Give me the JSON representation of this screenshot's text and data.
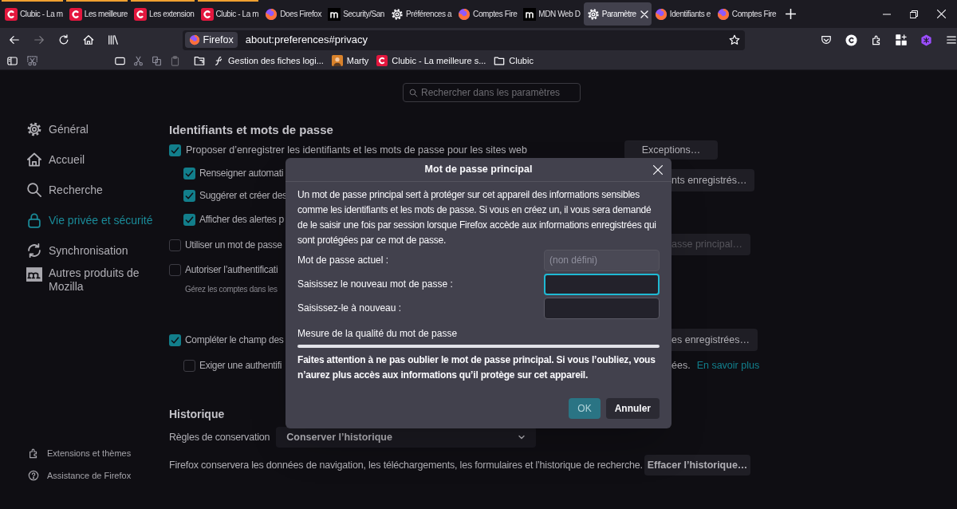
{
  "tabs": [
    {
      "title": "Clubic - La m",
      "kind": "clubic",
      "selected": false,
      "color": "#f0a030"
    },
    {
      "title": "Les meilleure",
      "kind": "clubic",
      "selected": false,
      "color": "#f0a030"
    },
    {
      "title": "Les extension",
      "kind": "clubic",
      "selected": false,
      "color": "#f0a030"
    },
    {
      "title": "Clubic - La m",
      "kind": "clubic",
      "selected": false,
      "color": "#f0a030"
    },
    {
      "title": "Does Firefox",
      "kind": "firefox",
      "selected": false
    },
    {
      "title": "Security/San",
      "kind": "mdn",
      "selected": false
    },
    {
      "title": "Préférences a",
      "kind": "gear",
      "selected": false
    },
    {
      "title": "Comptes Fire",
      "kind": "firefox",
      "selected": false
    },
    {
      "title": "MDN Web D",
      "kind": "mdn",
      "selected": false
    },
    {
      "title": "Paramètre",
      "kind": "gear",
      "selected": true
    },
    {
      "title": "Identifiants e",
      "kind": "firefox",
      "selected": false
    },
    {
      "title": "Comptes Fire",
      "kind": "firefox",
      "selected": false
    }
  ],
  "navbar": {
    "identity": "Firefox",
    "url": "about:preferences#privacy"
  },
  "bookmarks": [
    {
      "label": "Gestion des fiches logi...",
      "kind": "script"
    },
    {
      "label": "Marty",
      "kind": "avatar"
    },
    {
      "label": "Clubic - La meilleure s...",
      "kind": "clubic"
    },
    {
      "label": "Clubic",
      "kind": "folder"
    }
  ],
  "search": {
    "placeholder": "Rechercher dans les paramètres"
  },
  "sidebar": {
    "items": [
      {
        "label": "Général",
        "kind": "general",
        "selected": false
      },
      {
        "label": "Accueil",
        "kind": "home",
        "selected": false
      },
      {
        "label": "Recherche",
        "kind": "search",
        "selected": false
      },
      {
        "label": "Vie privée et sécurité",
        "kind": "privacy",
        "selected": true
      },
      {
        "label": "Synchronisation",
        "kind": "sync",
        "selected": false
      },
      {
        "label": "Autres produits de Mozilla",
        "kind": "mozilla",
        "selected": false
      }
    ],
    "footer": [
      {
        "label": "Extensions et thèmes",
        "kind": "extensions"
      },
      {
        "label": "Assistance de Firefox",
        "kind": "help"
      }
    ]
  },
  "passwords": {
    "heading": "Identifiants et mots de passe",
    "offer": {
      "label": "Proposer d’enregistrer les identifiants et les mots de passe pour les sites web",
      "checked": true,
      "button": "Exceptions…"
    },
    "rows": [
      {
        "label": "Renseigner automati",
        "checked": true,
        "children": []
      },
      {
        "label": "Suggérer et créer des",
        "checked": true
      },
      {
        "label": "Afficher des alertes p",
        "checked": true
      },
      {
        "label": "Utiliser un mot de passe",
        "checked": false
      },
      {
        "label": "Autoriser l’authentificati",
        "checked": false,
        "description": "Gérez les comptes dans les"
      },
      {
        "label": "Compléter le champ des",
        "checked": true
      },
      {
        "label": "Exiger une authentifi",
        "checked": false
      }
    ],
    "right_buttons": [
      {
        "label": "nts enregistrés…",
        "disabled": false
      },
      {
        "label": "asse principal…",
        "disabled": true
      },
      {
        "label": "es enregistrées…",
        "disabled": false
      }
    ],
    "note_tail": "ées.",
    "learn_more": "En savoir plus"
  },
  "history": {
    "heading": "Historique",
    "rule_label": "Règles de conservation",
    "rule_value": "Conserver l’historique",
    "description": "Firefox conservera les données de navigation, les téléchargements, les formulaires et l’historique de recherche.",
    "clear_button": "Effacer l’historique…"
  },
  "dialog": {
    "title": "Mot de passe principal",
    "intro": "Un mot de passe principal sert à protéger sur cet appareil des informations sensibles comme les identifiants et les mots de passe. Si vous en créez un, il vous sera demandé de le saisir une fois par session lorsque Firefox accède aux informations enregistrées qui sont protégées par ce mot de passe.",
    "fields": [
      {
        "label": "Mot de passe actuel :",
        "placeholder": "(non défini)",
        "disabled": true,
        "focused": false
      },
      {
        "label": "Saisissez le nouveau mot de passe :",
        "disabled": false,
        "focused": true
      },
      {
        "label": "Saisissez-le à nouveau :",
        "disabled": false,
        "focused": false
      }
    ],
    "meter": {
      "label": "Mesure de la qualité du mot de passe",
      "level": 0
    },
    "warning": "Faites attention à ne pas oublier le mot de passe principal. Si vous l’oubliez, vous n’aurez plus accès aux informations qu’il protège sur cet appareil.",
    "buttons": [
      {
        "label": "OK",
        "disabled": true
      },
      {
        "label": "Annuler",
        "disabled": false
      }
    ]
  }
}
